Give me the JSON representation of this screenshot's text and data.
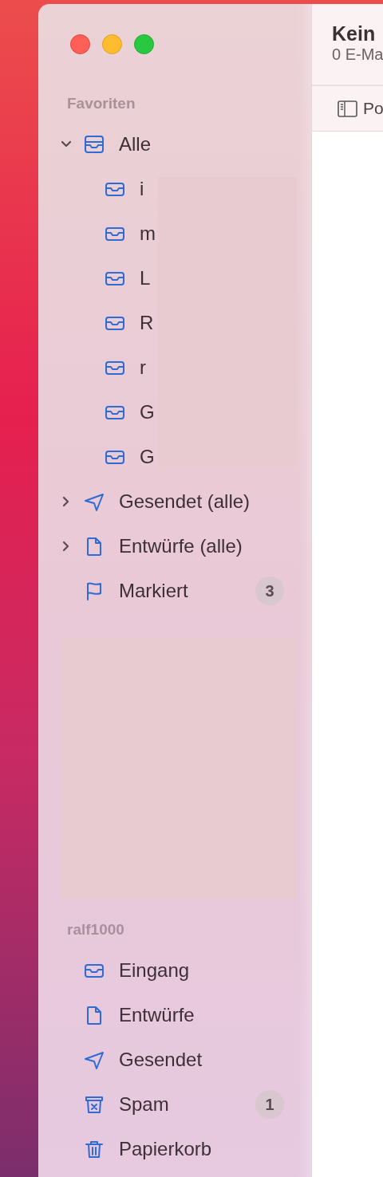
{
  "sidebar": {
    "sections": [
      {
        "title": "Favoriten",
        "items": [
          {
            "label": "Alle",
            "kind": "all",
            "expanded": true,
            "children": [
              {
                "label": "i",
                "kind": "inbox"
              },
              {
                "label": "m",
                "kind": "inbox"
              },
              {
                "label": "L",
                "kind": "inbox"
              },
              {
                "label": "R",
                "kind": "inbox"
              },
              {
                "label": "r",
                "kind": "inbox"
              },
              {
                "label": "G",
                "kind": "inbox"
              },
              {
                "label": "G",
                "kind": "inbox"
              }
            ]
          },
          {
            "label": "Gesendet (alle)",
            "kind": "send",
            "expanded": false
          },
          {
            "label": "Entwürfe (alle)",
            "kind": "doc",
            "expanded": false
          },
          {
            "label": "Markiert",
            "kind": "flag",
            "badge": "3"
          }
        ]
      },
      {
        "title": "ralf1000",
        "items": [
          {
            "label": "Eingang",
            "kind": "inbox"
          },
          {
            "label": "Entwürfe",
            "kind": "doc"
          },
          {
            "label": "Gesendet",
            "kind": "send"
          },
          {
            "label": "Spam",
            "kind": "spam",
            "badge": "1"
          },
          {
            "label": "Papierkorb",
            "kind": "trash"
          }
        ]
      }
    ]
  },
  "message_list": {
    "title": "Kein",
    "subtitle": "0 E-Ma",
    "toolbar": [
      {
        "label": "Po"
      }
    ]
  }
}
